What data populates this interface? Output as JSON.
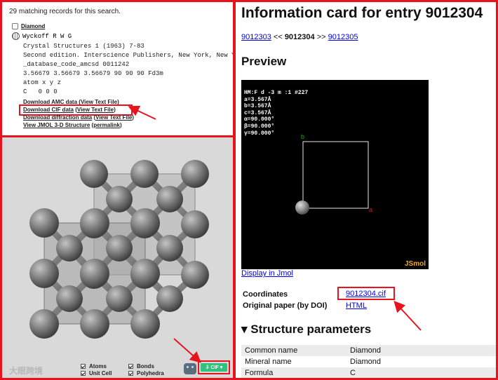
{
  "amc": {
    "search_count_text": "29 matching records for this search.",
    "entry_name": "Diamond",
    "author_line": "Wyckoff R W G",
    "citation_lines": [
      "Crystal Structures 1 (1963) 7-83",
      "Second edition. Interscience Publishers, New York, New York",
      "_database_code_amcsd 0011242",
      "3.56679 3.56679 3.56679 90 90 90 Fd3m",
      "atom x y z",
      "C   0 0 0"
    ],
    "downloads": [
      {
        "label": "Download AMC data",
        "alt": "View Text File"
      },
      {
        "label": "Download CIF data",
        "alt": "View Text File"
      },
      {
        "label": "Download diffraction data",
        "alt": "View Text File"
      }
    ],
    "jmol_link": "View JMOL 3-D Structure",
    "permalink": "permalink"
  },
  "jmol_panel": {
    "watermark": "大眼跨境",
    "checkboxes": [
      {
        "label": "Atoms",
        "checked": true
      },
      {
        "label": "Unit Cell",
        "checked": true
      },
      {
        "label": "Bonds",
        "checked": true
      },
      {
        "label": "Polyhedra",
        "checked": true
      }
    ],
    "cif_button": "CIF",
    "accent_color": "#2ec27e"
  },
  "cod": {
    "title": "Information card for entry 9012304",
    "nav": {
      "prev": "9012303",
      "prev_sep": "<<",
      "current": "9012304",
      "next_sep": ">>",
      "next": "9012305"
    },
    "preview_heading": "Preview",
    "viewer_info": [
      "HM:F d -3 m :1 #227",
      "a=3.567Å",
      "b=3.567Å",
      "c=3.567Å",
      "α=90.000°",
      "β=90.000°",
      "γ=90.000°"
    ],
    "axis_b": "b",
    "axis_a": "a",
    "jsmol_label": "JSmol",
    "display_link": "Display in Jmol",
    "coordinates_label": "Coordinates",
    "coordinates_value": "9012304.cif",
    "paper_label": "Original paper (by DOI)",
    "paper_value": "HTML",
    "structure_heading": "▾ Structure parameters",
    "params": [
      {
        "key": "Common name",
        "value": "Diamond"
      },
      {
        "key": "Mineral name",
        "value": "Diamond"
      },
      {
        "key": "Formula",
        "value": "C"
      }
    ],
    "highlight_color": "#e8141d"
  }
}
